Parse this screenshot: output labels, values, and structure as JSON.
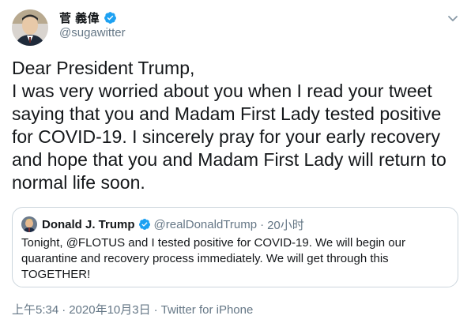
{
  "tweet": {
    "author": {
      "display_name": "菅 義偉",
      "handle": "@sugawitter",
      "verified": true
    },
    "text": "Dear President Trump,\nI was very worried about you when I read your tweet saying that you and Madam First Lady tested positive for COVID-19. I sincerely pray for your early recovery and hope that you and Madam First Lady will return to normal life soon.",
    "menu_icon": "chevron-down-icon"
  },
  "quoted": {
    "display_name": "Donald J. Trump",
    "verified": true,
    "handle": "@realDonaldTrump",
    "separator": "·",
    "time": "20小时",
    "text": "Tonight, @FLOTUS and I tested positive for COVID-19. We will begin our quarantine and recovery process immediately. We will get through this TOGETHER!"
  },
  "footer": {
    "time": "上午5:34",
    "separator": "·",
    "date": "2020年10月3日",
    "source": "Twitter for iPhone"
  },
  "colors": {
    "verified_blue": "#1da1f2",
    "secondary_text": "#657786",
    "border": "#ccd6dd"
  }
}
